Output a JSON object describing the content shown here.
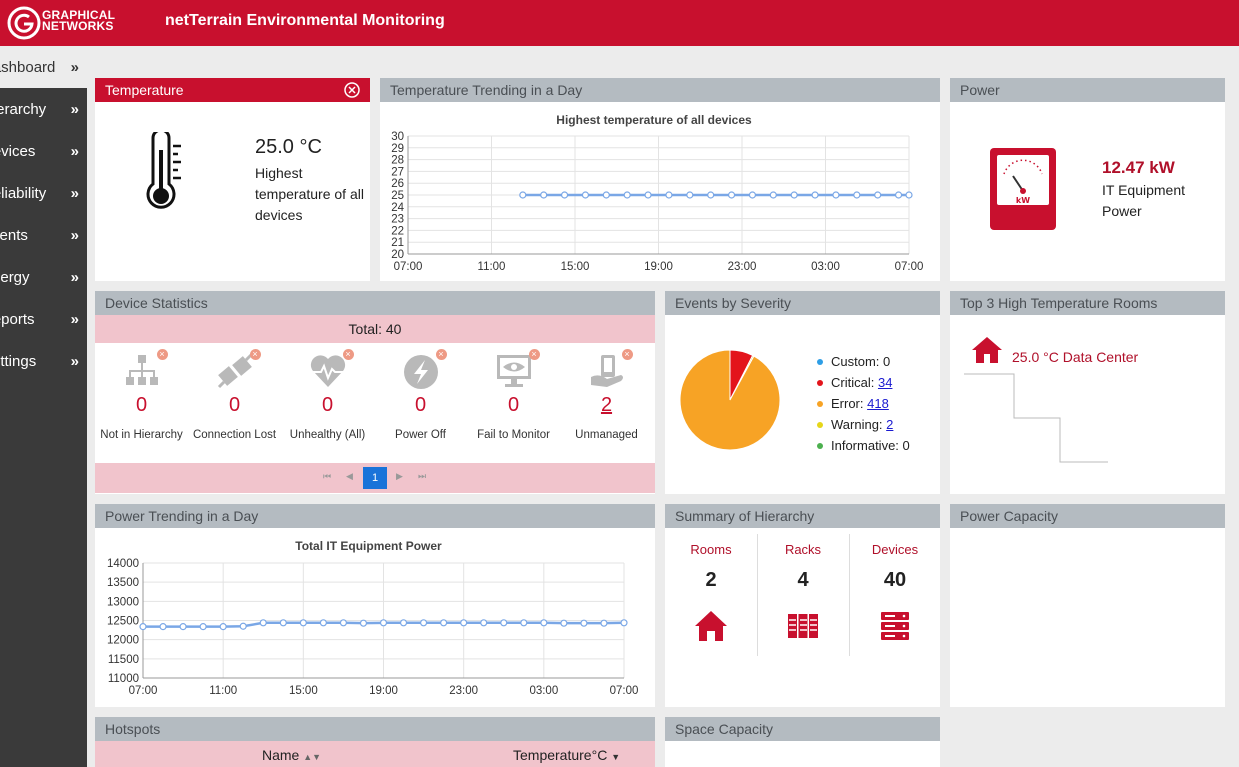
{
  "header": {
    "logo_line1": "GRAPHICAL",
    "logo_line2": "NETWORKS",
    "title": "netTerrain Environmental Monitoring"
  },
  "sidebar": {
    "items": [
      {
        "label": "Dashboard"
      },
      {
        "label": "Hierarchy"
      },
      {
        "label": "Devices"
      },
      {
        "label": "Reliability"
      },
      {
        "label": "Events"
      },
      {
        "label": "Energy"
      },
      {
        "label": "Reports"
      },
      {
        "label": "Settings"
      }
    ],
    "chevron": "»"
  },
  "temperature": {
    "title": "Temperature",
    "value": "25.0 °C",
    "description": "Highest temperature of all devices"
  },
  "temp_trend": {
    "title": "Temperature Trending in a Day",
    "chart_title": "Highest temperature of all devices"
  },
  "power": {
    "title": "Power",
    "value": "12.47 kW",
    "description": "IT Equipment Power",
    "meter_unit": "kW"
  },
  "device_stats": {
    "title": "Device Statistics",
    "total": "Total: 40",
    "items": [
      {
        "label": "Not in Hierarchy",
        "value": "0"
      },
      {
        "label": "Connection Lost",
        "value": "0"
      },
      {
        "label": "Unhealthy (All)",
        "value": "0"
      },
      {
        "label": "Power Off",
        "value": "0"
      },
      {
        "label": "Fail to Monitor",
        "value": "0"
      },
      {
        "label": "Unmanaged",
        "value": "2"
      }
    ],
    "pager": {
      "current": "1"
    }
  },
  "events": {
    "title": "Events by Severity",
    "legend": [
      {
        "label": "Custom:",
        "value": "0",
        "color": "#2e9ee6",
        "link": false
      },
      {
        "label": "Critical:",
        "value": "34",
        "color": "#e3141b",
        "link": true
      },
      {
        "label": "Error:",
        "value": "418",
        "color": "#f7a325",
        "link": true
      },
      {
        "label": "Warning:",
        "value": "2",
        "color": "#e6d619",
        "link": true
      },
      {
        "label": "Informative:",
        "value": "0",
        "color": "#4cb04f",
        "link": false
      }
    ]
  },
  "top_rooms": {
    "title": "Top 3 High Temperature Rooms",
    "rooms": [
      {
        "label": "25.0 °C Data Center"
      }
    ]
  },
  "power_trend": {
    "title": "Power Trending in a Day",
    "chart_title": "Total IT Equipment Power"
  },
  "summary": {
    "title": "Summary of Hierarchy",
    "columns": [
      {
        "label": "Rooms",
        "value": "2"
      },
      {
        "label": "Racks",
        "value": "4"
      },
      {
        "label": "Devices",
        "value": "40"
      }
    ]
  },
  "power_capacity": {
    "title": "Power Capacity"
  },
  "hotspots": {
    "title": "Hotspots",
    "col_name": "Name",
    "col_temp": "Temperature°C"
  },
  "space_capacity": {
    "title": "Space Capacity"
  },
  "colors": {
    "brand": "#c8102e",
    "line": "#7aa7e6",
    "panel_header": "#b4bbc1",
    "pink": "#f1c4cc"
  },
  "chart_data": [
    {
      "type": "line",
      "title": "Highest temperature of all devices",
      "xlabel": "",
      "ylabel": "",
      "x_ticks": [
        "07:00",
        "11:00",
        "15:00",
        "19:00",
        "23:00",
        "03:00",
        "07:00"
      ],
      "y_ticks": [
        "20",
        "21",
        "22",
        "23",
        "24",
        "25",
        "26",
        "27",
        "28",
        "29",
        "30"
      ],
      "ylim": [
        20,
        30
      ],
      "x": [
        12.5,
        13.5,
        14.5,
        15.5,
        16.5,
        17.5,
        18.5,
        19.5,
        20.5,
        21.5,
        22.5,
        23.5,
        24.5,
        25.5,
        26.5,
        27.5,
        28.5,
        29.5,
        30.5,
        31.0
      ],
      "series": [
        {
          "values": [
            25,
            25,
            25,
            25,
            25,
            25,
            25,
            25,
            25,
            25,
            25,
            25,
            25,
            25,
            25,
            25,
            25,
            25,
            25,
            25
          ]
        }
      ],
      "xlim": [
        7,
        31
      ],
      "grid": true
    },
    {
      "type": "line",
      "title": "Total IT Equipment Power",
      "xlabel": "",
      "ylabel": "",
      "x_ticks": [
        "07:00",
        "11:00",
        "15:00",
        "19:00",
        "23:00",
        "03:00",
        "07:00"
      ],
      "y_ticks": [
        "11000",
        "11500",
        "12000",
        "12500",
        "13000",
        "13500",
        "14000"
      ],
      "ylim": [
        11000,
        14000
      ],
      "x": [
        7,
        8,
        9,
        10,
        11,
        12,
        13,
        14,
        15,
        16,
        17,
        18,
        19,
        20,
        21,
        22,
        23,
        24,
        25,
        26,
        27,
        28,
        29,
        30,
        31
      ],
      "series": [
        {
          "values": [
            12340,
            12340,
            12340,
            12340,
            12340,
            12350,
            12440,
            12440,
            12440,
            12440,
            12440,
            12430,
            12440,
            12440,
            12440,
            12440,
            12440,
            12440,
            12440,
            12440,
            12440,
            12430,
            12430,
            12430,
            12440
          ]
        }
      ],
      "xlim": [
        7,
        31
      ],
      "grid": true
    },
    {
      "type": "pie",
      "title": "",
      "categories": [
        "Custom",
        "Critical",
        "Error",
        "Warning",
        "Informative"
      ],
      "values": [
        0,
        34,
        418,
        2,
        0
      ],
      "colors": [
        "#2e9ee6",
        "#e3141b",
        "#f7a325",
        "#e6d619",
        "#4cb04f"
      ]
    }
  ]
}
